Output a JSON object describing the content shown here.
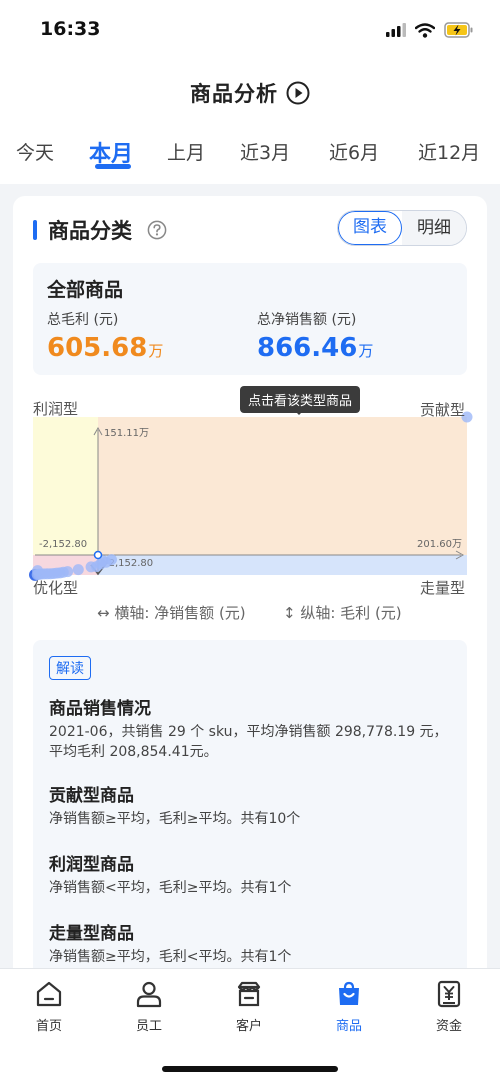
{
  "status": {
    "time": "16:33"
  },
  "nav": {
    "title": "商品分析"
  },
  "tabs": [
    "今天",
    "本月",
    "上月",
    "近3月",
    "近6月",
    "近12月"
  ],
  "active_tab": 1,
  "section": {
    "title": "商品分类"
  },
  "view_toggle": {
    "chart_label": "图表",
    "detail_label": "明细",
    "active": "chart"
  },
  "summary": {
    "title": "全部商品",
    "gross_profit_label": "总毛利 (元)",
    "gross_profit_value": "605.68",
    "gross_profit_unit": "万",
    "net_sales_label": "总净销售额 (元)",
    "net_sales_value": "866.46",
    "net_sales_unit": "万"
  },
  "tooltip": "点击看该类型商品",
  "quadrants": {
    "profit": "利润型",
    "contribution": "贡献型",
    "optimize": "优化型",
    "volume": "走量型"
  },
  "chart_data": {
    "type": "scatter",
    "y_max_label": "151.11万",
    "x_min_label": "-2,152.80",
    "y_min_label": "-2,152.80",
    "x_max_label": "201.60万",
    "xlim": [
      -2152.8,
      2016000
    ],
    "ylim": [
      -2152.8,
      1511100
    ],
    "avg_x": 298778.19,
    "avg_y": 208854.41,
    "points": [
      {
        "x": -2000,
        "y": -1500
      },
      {
        "x": 2016000,
        "y": 1511100
      },
      {
        "x": 8000,
        "y": 2000
      },
      {
        "x": 15000,
        "y": 5000
      },
      {
        "x": 25000,
        "y": 6500
      },
      {
        "x": 40000,
        "y": 8000
      },
      {
        "x": 55000,
        "y": 9500
      },
      {
        "x": 70000,
        "y": 10000
      },
      {
        "x": 85000,
        "y": 12000
      },
      {
        "x": 100000,
        "y": 16000
      },
      {
        "x": 115000,
        "y": 18000
      },
      {
        "x": 130000,
        "y": 25000
      },
      {
        "x": 150000,
        "y": 30000
      },
      {
        "x": 200000,
        "y": 50000
      },
      {
        "x": 260000,
        "y": 75000
      },
      {
        "x": 285000,
        "y": 78000
      },
      {
        "x": 305000,
        "y": 105000
      },
      {
        "x": 330000,
        "y": 120000
      },
      {
        "x": 315000,
        "y": 135000
      },
      {
        "x": 355000,
        "y": 145000
      },
      {
        "x": 10000,
        "y": 40000
      }
    ]
  },
  "legend": {
    "x_axis": "横轴: 净销售额 (元)",
    "y_axis": "纵轴: 毛利 (元)"
  },
  "interpretation": {
    "badge": "解读",
    "items": [
      {
        "title": "商品销售情况",
        "text": "2021-06，共销售 29 个 sku，平均净销售额 298,778.19 元，平均毛利 208,854.41元。"
      },
      {
        "title": "贡献型商品",
        "text": "净销售额≥平均，毛利≥平均。共有10个"
      },
      {
        "title": "利润型商品",
        "text": "净销售额<平均，毛利≥平均。共有1个"
      },
      {
        "title": "走量型商品",
        "text": "净销售额≥平均，毛利<平均。共有1个"
      }
    ]
  },
  "bottom_nav": [
    {
      "label": "首页",
      "icon": "home-icon"
    },
    {
      "label": "员工",
      "icon": "staff-icon"
    },
    {
      "label": "客户",
      "icon": "customer-icon"
    },
    {
      "label": "商品",
      "icon": "goods-icon"
    },
    {
      "label": "资金",
      "icon": "finance-icon"
    }
  ],
  "active_nav": 3,
  "colors": {
    "accent": "#1e6cf2",
    "profit_quadrant": "#fdfbd9",
    "contribution_quadrant": "#fbe8d5",
    "volume_quadrant": "#d6e4fb",
    "optimize_quadrant": "#f7d8df",
    "point": "#9db8f7",
    "gross_profit_value": "#f08a1e"
  }
}
